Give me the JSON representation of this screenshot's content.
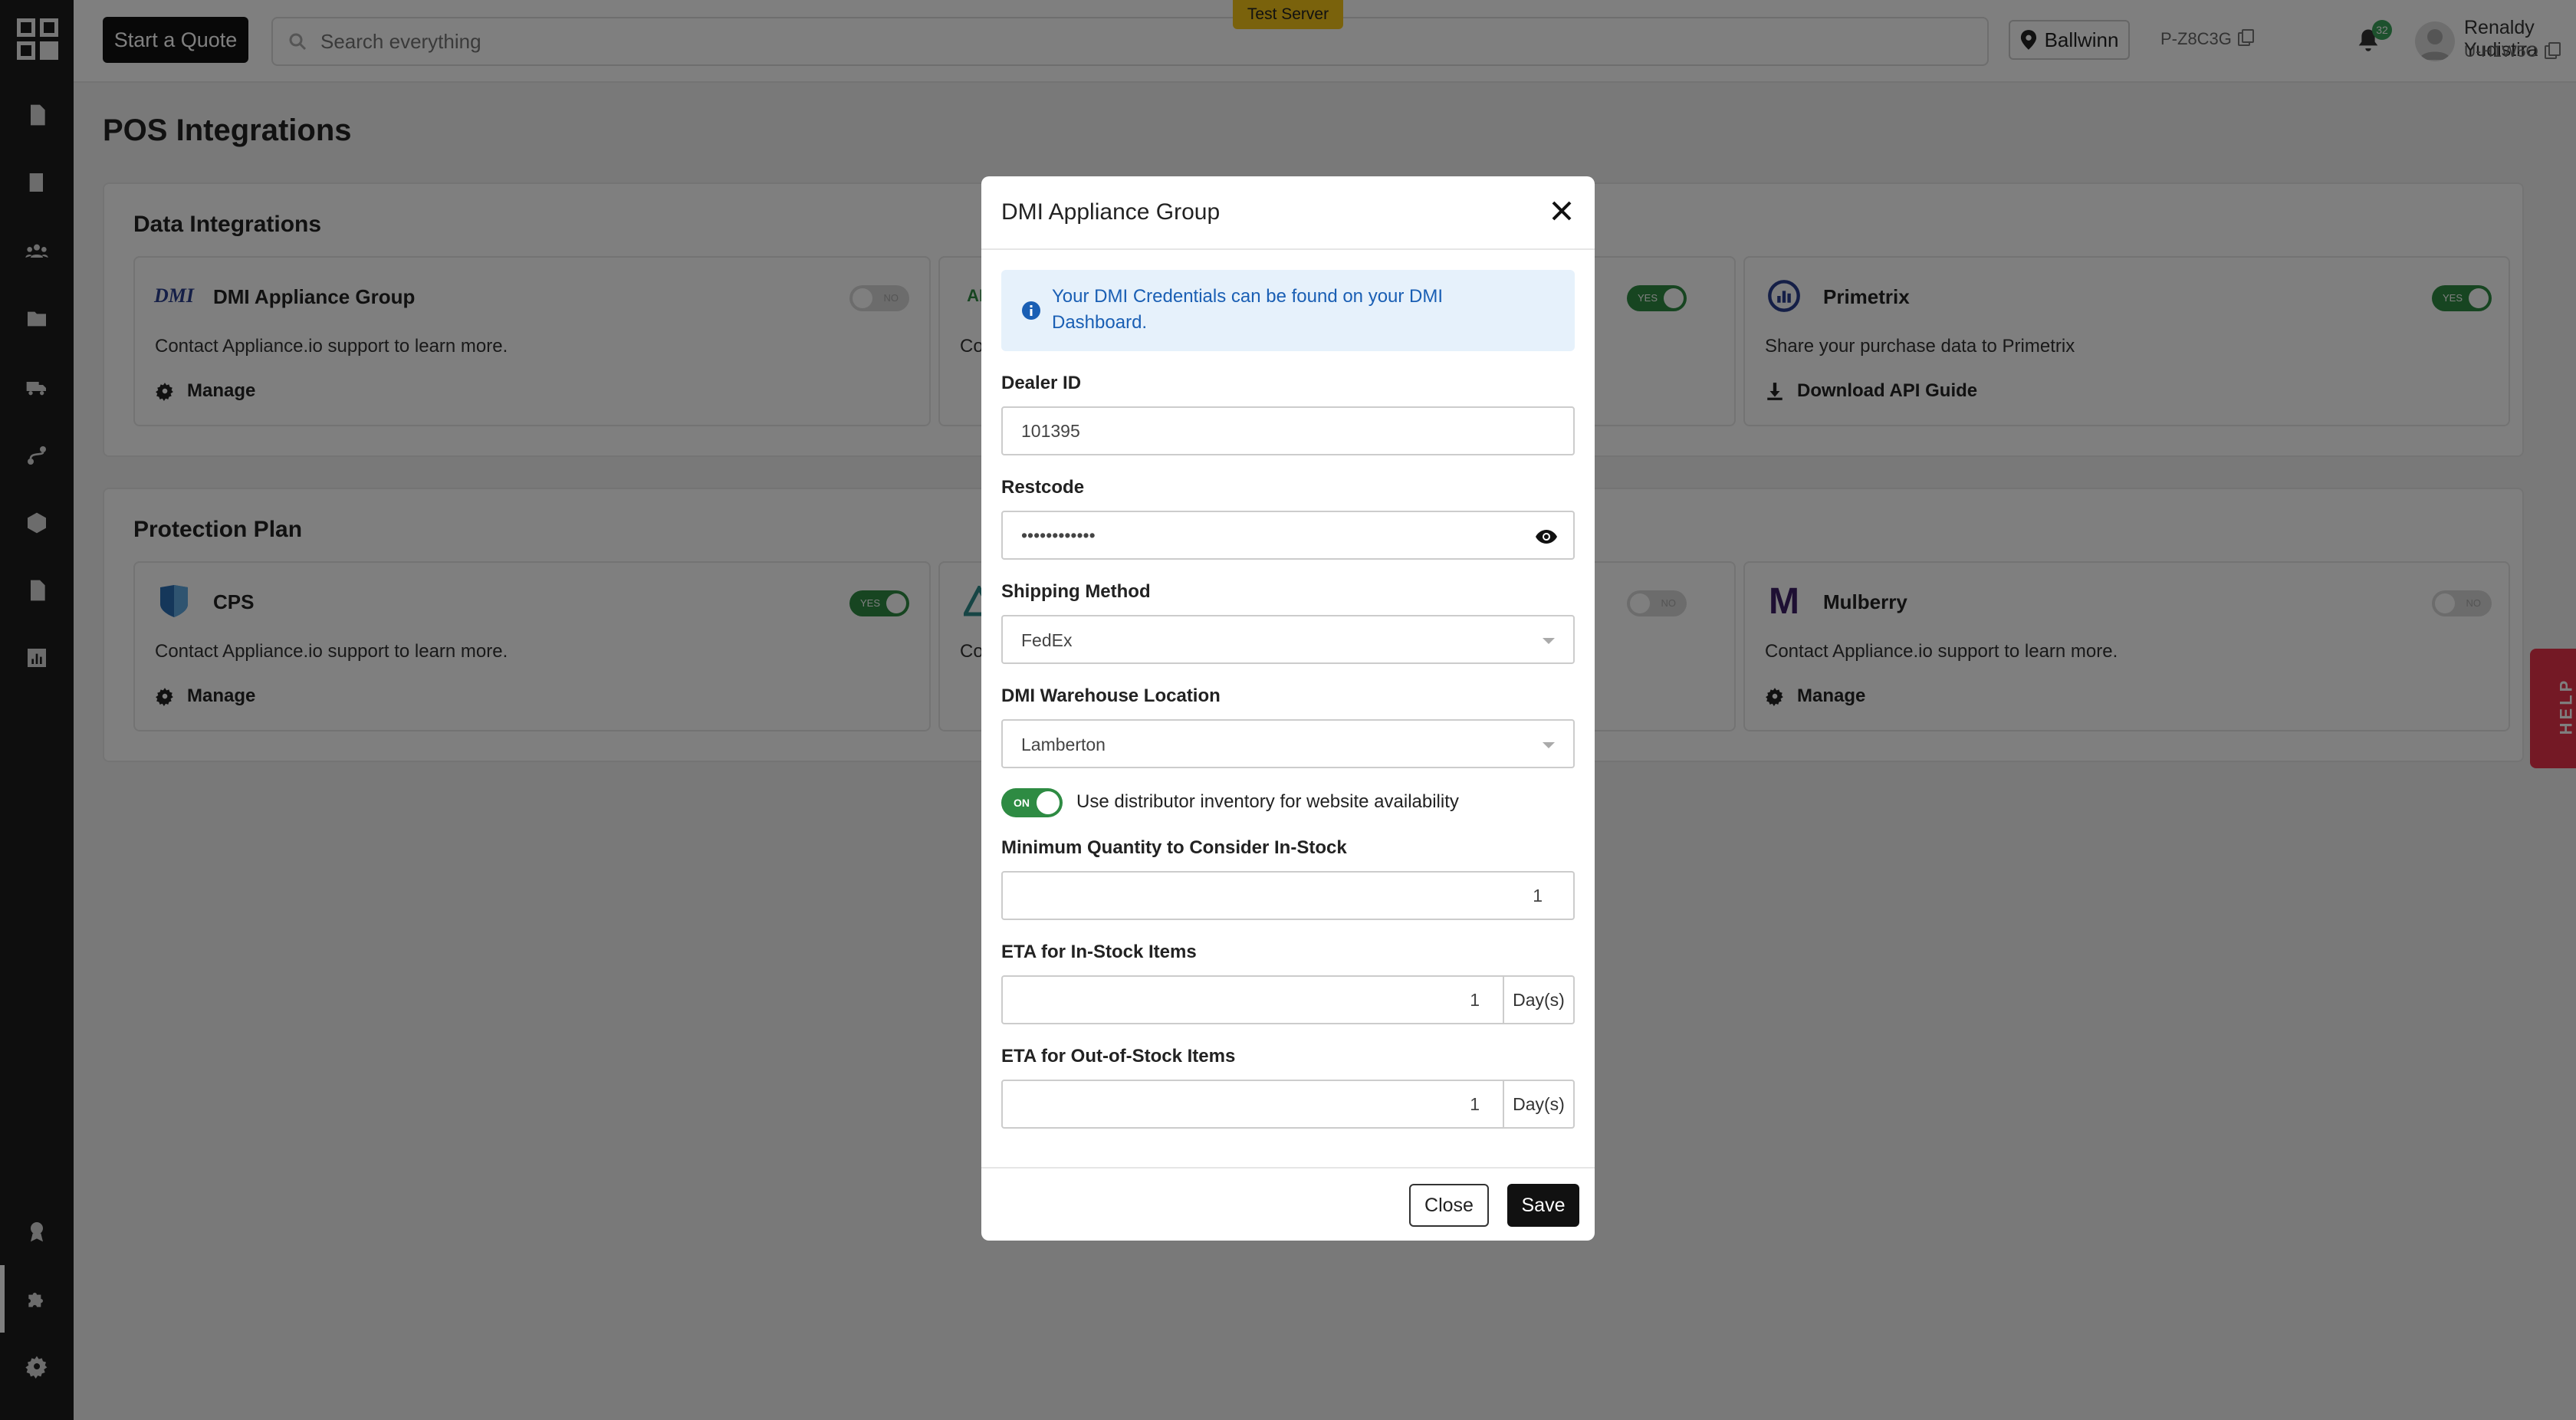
{
  "topbar": {
    "start_quote_label": "Start a Quote",
    "search_placeholder": "Search everything",
    "test_server_badge": "Test Server",
    "location_label": "Ballwinn",
    "project_code": "P-Z8C3G",
    "notification_count": "32",
    "user_name": "Renaldy Yudistira",
    "user_code": "U-H1W5O"
  },
  "page": {
    "title": "POS Integrations"
  },
  "data_integrations": {
    "title": "Data Integrations",
    "cards": [
      {
        "name": "DMI Appliance Group",
        "logo_text": "DMI",
        "toggle_label": "NO",
        "toggle_on": false,
        "description": "Contact Appliance.io support to learn more.",
        "action_label": "Manage",
        "action_icon": "gear-icon"
      },
      {
        "name": "",
        "logo_text": "AD",
        "toggle_label": "YES",
        "toggle_on": true,
        "description": "Co",
        "action_label": "",
        "action_icon": "gear-icon"
      },
      {
        "name": "Primetrix",
        "toggle_label": "YES",
        "toggle_on": true,
        "description": "Share your purchase data to Primetrix",
        "action_label": "Download API Guide",
        "action_icon": "download-icon"
      }
    ]
  },
  "protection_plan": {
    "title": "Protection Plan",
    "cards": [
      {
        "name": "CPS",
        "toggle_label": "YES",
        "toggle_on": true,
        "description": "Contact Appliance.io support to learn more.",
        "action_label": "Manage",
        "action_icon": "gear-icon"
      },
      {
        "name": "",
        "toggle_label": "NO",
        "toggle_on": false,
        "description": "Co",
        "action_label": "",
        "action_icon": "gear-icon"
      },
      {
        "name": "Mulberry",
        "logo_text": "M",
        "toggle_label": "NO",
        "toggle_on": false,
        "description": "Contact Appliance.io support to learn more.",
        "action_label": "Manage",
        "action_icon": "gear-icon"
      }
    ]
  },
  "help_tab_label": "HELP",
  "modal": {
    "title": "DMI Appliance Group",
    "info_text": "Your DMI Credentials can be found on your DMI Dashboard.",
    "dealer_id_label": "Dealer ID",
    "dealer_id_value": "101395",
    "restcode_label": "Restcode",
    "restcode_value": "••••••••••••",
    "shipping_method_label": "Shipping Method",
    "shipping_method_value": "FedEx",
    "warehouse_label": "DMI Warehouse Location",
    "warehouse_value": "Lamberton",
    "inventory_toggle_label": "ON",
    "inventory_toggle_on": true,
    "inventory_toggle_text": "Use distributor inventory for website availability",
    "min_qty_label": "Minimum Quantity to Consider In-Stock",
    "min_qty_value": "1",
    "eta_in_stock_label": "ETA for In-Stock Items",
    "eta_in_stock_value": "1",
    "eta_out_stock_label": "ETA for Out-of-Stock Items",
    "eta_out_stock_value": "1",
    "days_unit": "Day(s)",
    "close_label": "Close",
    "save_label": "Save"
  },
  "colors": {
    "toggle_on": "#2e8b43",
    "test_server": "#f5c518",
    "info_bg": "#e6f1fb",
    "info_text": "#1a5fb4",
    "help_tab": "#e8334a"
  },
  "sidebar_icons": [
    "dollar-doc-icon",
    "ledger-icon",
    "users-icon",
    "folder-icon",
    "truck-icon",
    "route-icon",
    "box-icon",
    "document-icon",
    "chart-icon",
    "badge-icon",
    "puzzle-icon",
    "settings-icon"
  ]
}
